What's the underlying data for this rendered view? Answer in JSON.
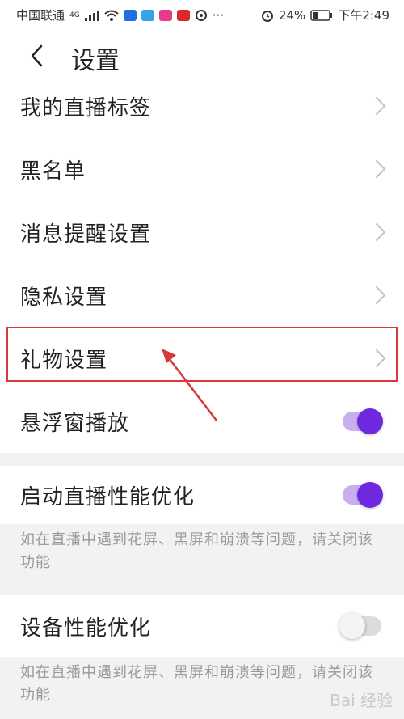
{
  "status_bar": {
    "carrier": "中国联通",
    "network": "4G",
    "battery": "24%",
    "time": "下午2:49",
    "dots": "···"
  },
  "nav": {
    "title": "设置"
  },
  "menu": [
    {
      "label": "我的直播标签"
    },
    {
      "label": "黑名单"
    },
    {
      "label": "消息提醒设置"
    },
    {
      "label": "隐私设置"
    },
    {
      "label": "礼物设置"
    }
  ],
  "toggles": {
    "floating_window": {
      "label": "悬浮窗播放",
      "state": "on"
    },
    "live_perf": {
      "label": "启动直播性能优化",
      "state": "on",
      "hint": "如在直播中遇到花屏、黑屏和崩溃等问题，请关闭该功能"
    },
    "device_perf": {
      "label": "设备性能优化",
      "state": "off",
      "hint": "如在直播中遇到花屏、黑屏和崩溃等问题，请关闭该功能"
    }
  },
  "colors": {
    "toggle_on_knob": "#6f28e0",
    "toggle_on_track": "#c9aef0",
    "annotation_red": "#d9383a"
  },
  "watermark": "Bai 经验"
}
